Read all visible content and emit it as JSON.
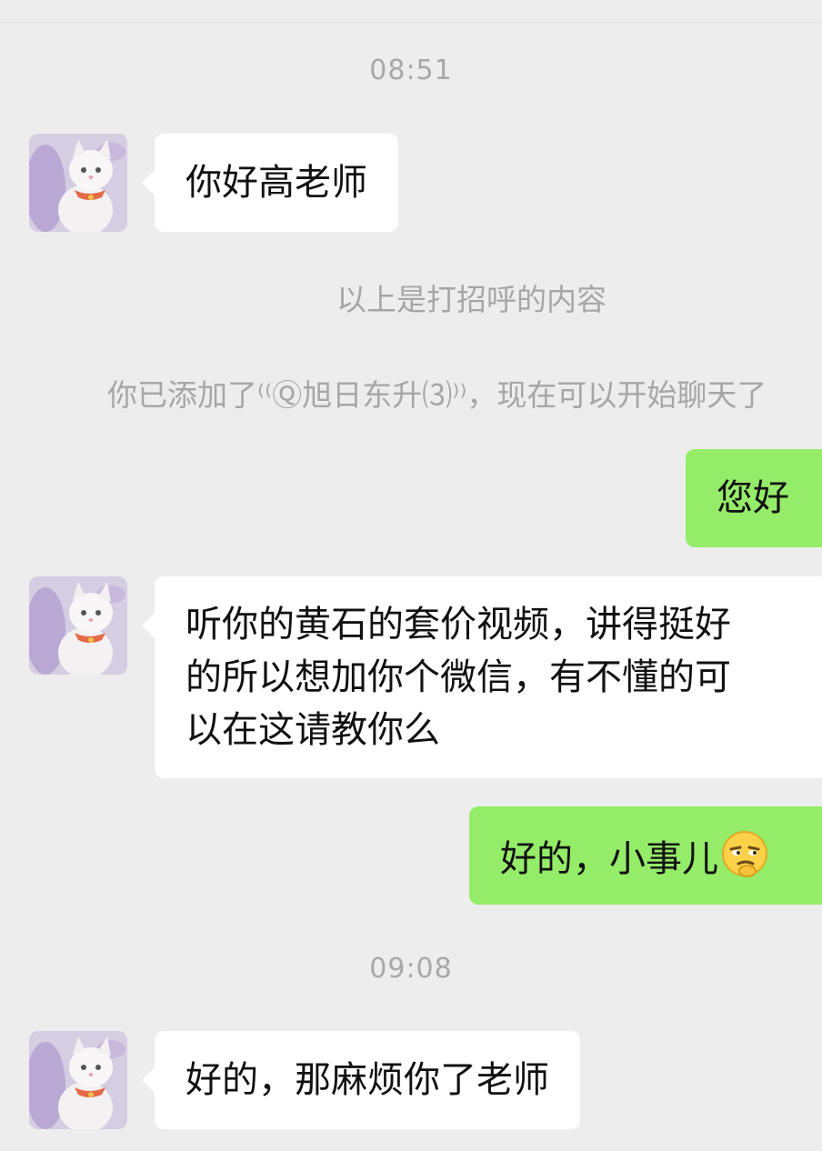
{
  "chat": {
    "timestamps": [
      "08:51",
      "09:08"
    ],
    "system_messages": {
      "greeting_note": "以上是打招呼的内容",
      "added_note": "你已添加了⁽⁽Ⓠ旭日东升⑶⁾⁾，现在可以开始聊天了"
    },
    "messages": [
      {
        "side": "left",
        "text": "你好高老师"
      },
      {
        "side": "right",
        "text": "您好"
      },
      {
        "side": "left",
        "lines": [
          "听你的黄石的套价视频，讲得挺好",
          "的所以想加你个微信，有不懂的可",
          "以在这请教你么"
        ]
      },
      {
        "side": "right",
        "text": "好的，小事儿",
        "emoji": "smirk-thinking-emoji"
      },
      {
        "side": "left",
        "text": "好的，那麻烦你了老师"
      }
    ],
    "avatar_icon": "white-cat-avatar"
  }
}
